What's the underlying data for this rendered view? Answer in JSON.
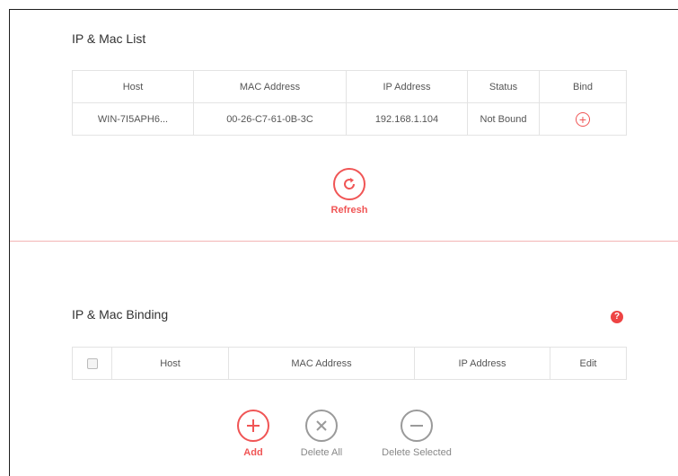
{
  "ip_mac_list": {
    "title": "IP & Mac List",
    "columns": [
      "Host",
      "MAC Address",
      "IP Address",
      "Status",
      "Bind"
    ],
    "rows": [
      {
        "host": "WIN-7I5APH6...",
        "mac": "00-26-C7-61-0B-3C",
        "ip": "192.168.1.104",
        "status": "Not Bound"
      }
    ],
    "refresh_label": "Refresh"
  },
  "ip_mac_binding": {
    "title": "IP & Mac Binding",
    "columns": [
      "Host",
      "MAC Address",
      "IP Address",
      "Edit"
    ],
    "add_label": "Add",
    "delete_all_label": "Delete All",
    "delete_selected_label": "Delete Selected"
  },
  "colors": {
    "accent": "#f05555",
    "help": "#ee4444",
    "neutral": "#9a9a9a"
  },
  "icons": {
    "refresh": "refresh-icon",
    "help": "help-icon",
    "bind": "plus-circle-icon",
    "add": "plus-icon",
    "delete_all": "x-icon",
    "delete_selected": "minus-icon"
  }
}
